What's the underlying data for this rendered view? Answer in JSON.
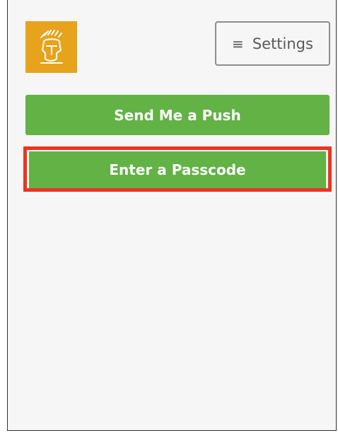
{
  "header": {
    "logo_icon": "spartan-helmet-icon",
    "logo_color": "#e8a31c",
    "settings": {
      "icon": "hamburger-menu-icon",
      "icon_glyph": "≡",
      "label": "Settings"
    }
  },
  "actions": {
    "push_label": "Send Me a Push",
    "passcode_label": "Enter a Passcode",
    "button_color": "#62b246",
    "highlight_color": "#ee3322"
  }
}
